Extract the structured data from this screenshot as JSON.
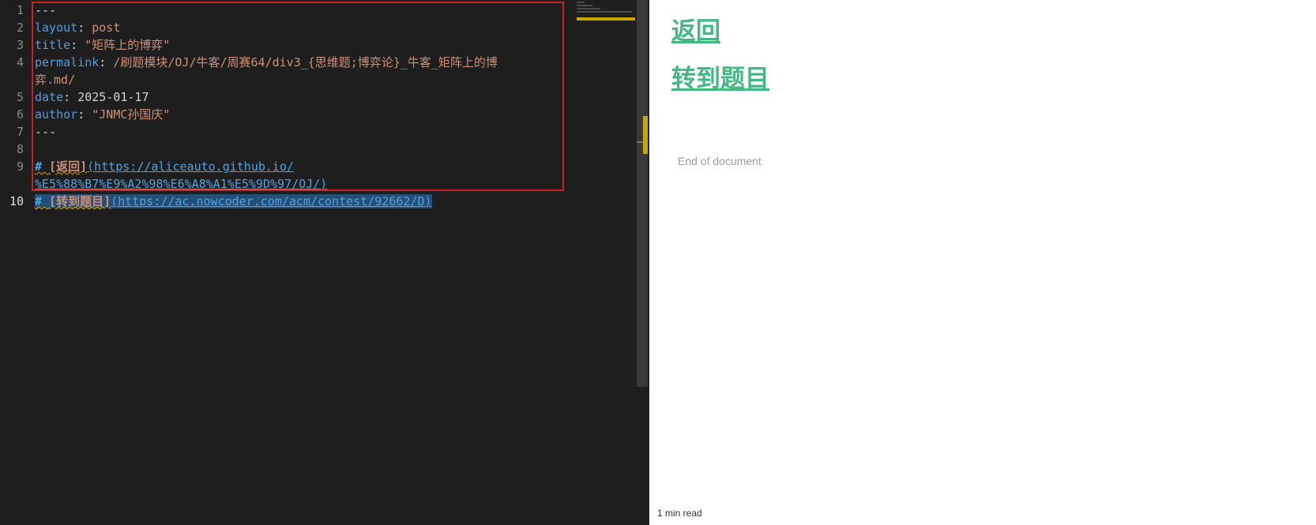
{
  "editor": {
    "line_numbers": [
      "1",
      "2",
      "3",
      "4",
      "5",
      "6",
      "7",
      "8",
      "9",
      "10"
    ],
    "lines": {
      "l1": "---",
      "l2_key": "layout",
      "l2_val": "post",
      "l3_key": "title",
      "l3_val": "\"矩阵上的博弈\"",
      "l4_key": "permalink",
      "l4_val_a": "/刷题模块/OJ/牛客/周赛64/div3_{思维题;博弈论}_牛客_矩阵上的博",
      "l4_val_b": "弈.md/",
      "l5_key": "date",
      "l5_val": "2025-01-17",
      "l6_key": "author",
      "l6_val": "\"JNMC孙国庆\"",
      "l7": "---",
      "l9_hash": "# ",
      "l9_text": "[返回]",
      "l9_url_a": "(https://aliceauto.github.io/",
      "l9_url_b": "%E5%88%B7%E9%A2%98%E6%A8%A1%E5%9D%97/OJ/)",
      "l10_hash": "# ",
      "l10_text": "[转到题目]",
      "l10_url": "(https://ac.nowcoder.com/acm/contest/92662/D)"
    }
  },
  "preview": {
    "heading_back": "返回",
    "heading_goto": "转到题目",
    "end_of_document": "End of document",
    "read_time": "1 min read"
  },
  "colors": {
    "accent_green": "#42b983",
    "selection_border": "#cc2222",
    "editor_bg": "#1e1e1e",
    "warning_yellow": "#c8a700"
  }
}
